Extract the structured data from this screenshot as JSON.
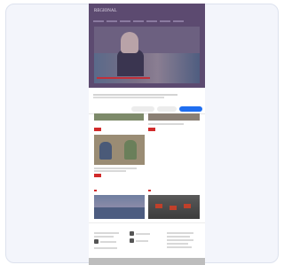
{
  "site": {
    "logo_text": "REGIONAL"
  },
  "nav": {
    "items": [
      "",
      "",
      "",
      "",
      "",
      "",
      "",
      ""
    ]
  },
  "hero": {
    "caption": ""
  },
  "consent": {
    "title": "",
    "options": [
      "",
      "",
      ""
    ],
    "link_text": "",
    "decline_label": "",
    "settings_label": "",
    "accept_label": ""
  },
  "articles": [
    {
      "caption": "",
      "tag": ""
    },
    {
      "caption": "",
      "tag": ""
    },
    {
      "caption": "",
      "tag": ""
    }
  ],
  "sections": {
    "left_label": "",
    "right_label": ""
  },
  "footer": {
    "col1_title": "",
    "col2_title": "",
    "col3_title": "",
    "bottom_text": ""
  },
  "colors": {
    "header": "#5c4a70",
    "accent": "#d12a2a",
    "accept_button": "#1f6ef0"
  }
}
